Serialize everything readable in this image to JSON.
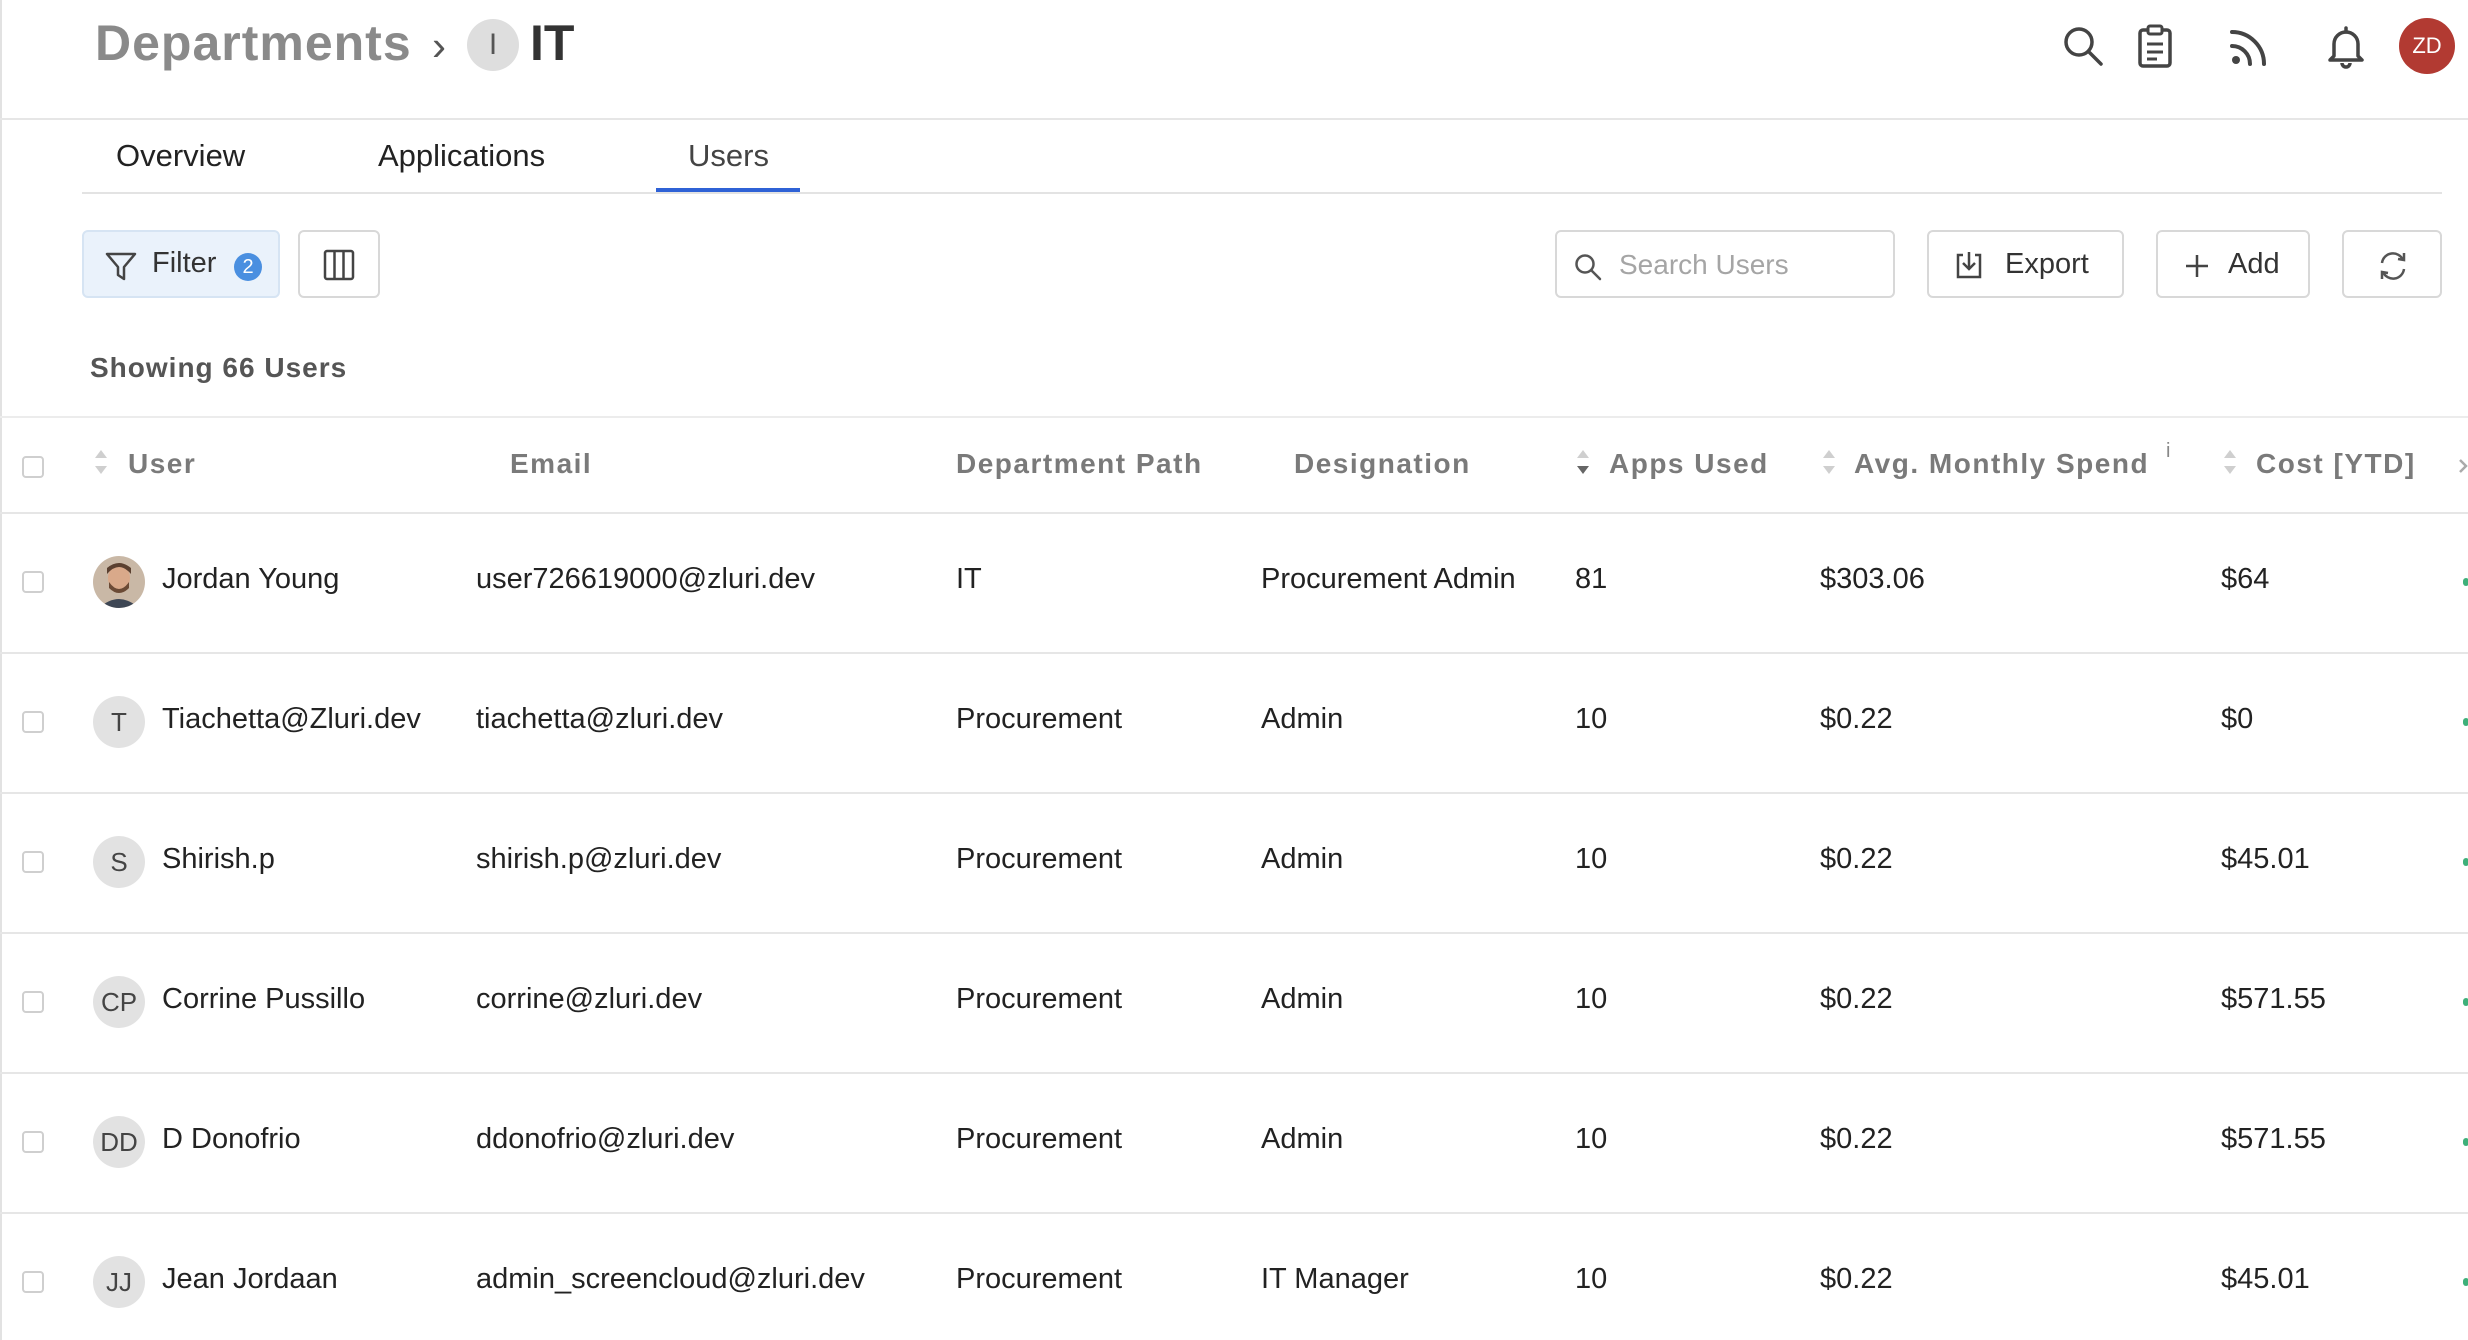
{
  "breadcrumb": {
    "root": "Departments",
    "separator": "›",
    "badge": "I",
    "current": "IT"
  },
  "header_icons": [
    "search-icon",
    "clipboard-icon",
    "feed-icon",
    "bell-icon"
  ],
  "user_avatar": {
    "initials": "ZD",
    "color": "#b23a32"
  },
  "tabs": [
    {
      "label": "Overview",
      "active": false
    },
    {
      "label": "Applications",
      "active": false
    },
    {
      "label": "Users",
      "active": true
    }
  ],
  "toolbar": {
    "filter_label": "Filter",
    "filter_count": "2",
    "search_placeholder": "Search Users",
    "export_label": "Export",
    "add_label": "Add"
  },
  "summary": {
    "count_text": "Showing 66 Users"
  },
  "table": {
    "columns": [
      "User",
      "Email",
      "Department Path",
      "Designation",
      "Apps Used",
      "Avg. Monthly Spend",
      "Cost [YTD]"
    ],
    "info_marker": "i",
    "rows": [
      {
        "avatar": "photo",
        "initials": "",
        "user": "Jordan Young",
        "email": "user726619000@zluri.dev",
        "department": "IT",
        "designation": "Procurement Admin",
        "apps_used": "81",
        "avg_spend": "$303.06",
        "cost_ytd": "$64"
      },
      {
        "avatar": "initials",
        "initials": "T",
        "user": "Tiachetta@Zluri.dev",
        "email": "tiachetta@zluri.dev",
        "department": "Procurement",
        "designation": "Admin",
        "apps_used": "10",
        "avg_spend": "$0.22",
        "cost_ytd": "$0"
      },
      {
        "avatar": "initials",
        "initials": "S",
        "user": "Shirish.p",
        "email": "shirish.p@zluri.dev",
        "department": "Procurement",
        "designation": "Admin",
        "apps_used": "10",
        "avg_spend": "$0.22",
        "cost_ytd": "$45.01"
      },
      {
        "avatar": "initials",
        "initials": "CP",
        "user": "Corrine Pussillo",
        "email": "corrine@zluri.dev",
        "department": "Procurement",
        "designation": "Admin",
        "apps_used": "10",
        "avg_spend": "$0.22",
        "cost_ytd": "$571.55"
      },
      {
        "avatar": "initials",
        "initials": "DD",
        "user": "D Donofrio",
        "email": "ddonofrio@zluri.dev",
        "department": "Procurement",
        "designation": "Admin",
        "apps_used": "10",
        "avg_spend": "$0.22",
        "cost_ytd": "$571.55"
      },
      {
        "avatar": "initials",
        "initials": "JJ",
        "user": "Jean Jordaan",
        "email": "admin_screencloud@zluri.dev",
        "department": "Procurement",
        "designation": "IT Manager",
        "apps_used": "10",
        "avg_spend": "$0.22",
        "cost_ytd": "$45.01"
      }
    ]
  },
  "colors": {
    "accent": "#2f62d6",
    "filter_badge": "#4a8fe0",
    "status_dot": "#3fb07a"
  }
}
